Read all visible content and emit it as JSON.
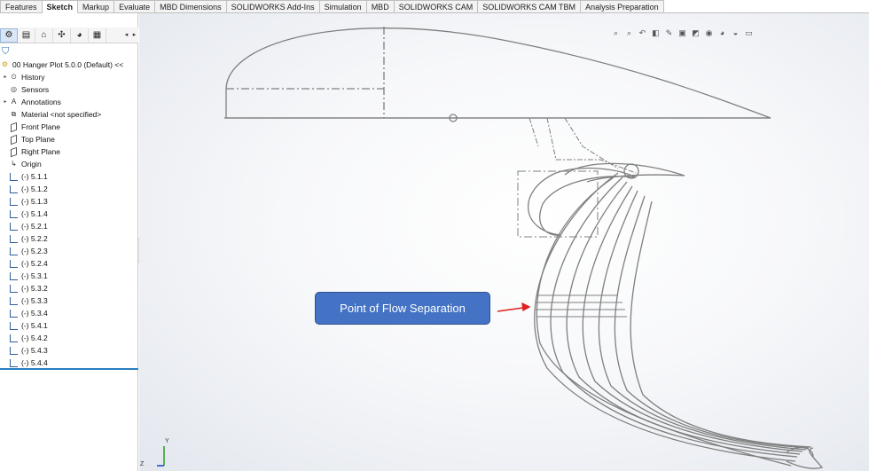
{
  "ribbon": {
    "tabs": [
      {
        "label": "Features"
      },
      {
        "label": "Sketch",
        "active": true
      },
      {
        "label": "Markup"
      },
      {
        "label": "Evaluate"
      },
      {
        "label": "MBD Dimensions"
      },
      {
        "label": "SOLIDWORKS Add-Ins"
      },
      {
        "label": "Simulation"
      },
      {
        "label": "MBD"
      },
      {
        "label": "SOLIDWORKS CAM"
      },
      {
        "label": "SOLIDWORKS CAM TBM"
      },
      {
        "label": "Analysis Preparation"
      }
    ]
  },
  "panel": {
    "toolbar_icons": [
      "feature-manager-icon",
      "property-manager-icon",
      "configuration-manager-icon",
      "dimxpert-icon",
      "display-manager-icon",
      "cam-icon"
    ],
    "tree": [
      {
        "label": "00 Hanger Plot 5.0.0 (Default) <<",
        "icon": "part-icon",
        "expandable": false,
        "indent": 0
      },
      {
        "label": "History",
        "icon": "history-icon",
        "expandable": true,
        "indent": 1
      },
      {
        "label": "Sensors",
        "icon": "sensors-icon",
        "expandable": false,
        "indent": 1
      },
      {
        "label": "Annotations",
        "icon": "annotations-icon",
        "expandable": true,
        "indent": 1
      },
      {
        "label": "Material <not specified>",
        "icon": "material-icon",
        "expandable": false,
        "indent": 1
      },
      {
        "label": "Front Plane",
        "icon": "plane-icon",
        "expandable": false,
        "indent": 1
      },
      {
        "label": "Top Plane",
        "icon": "plane-icon",
        "expandable": false,
        "indent": 1
      },
      {
        "label": "Right Plane",
        "icon": "plane-icon",
        "expandable": false,
        "indent": 1
      },
      {
        "label": "Origin",
        "icon": "origin-icon",
        "expandable": false,
        "indent": 1
      },
      {
        "label": "(-) 5.1.1",
        "icon": "sketch-icon",
        "expandable": false,
        "indent": 1
      },
      {
        "label": "(-) 5.1.2",
        "icon": "sketch-icon",
        "expandable": false,
        "indent": 1
      },
      {
        "label": "(-) 5.1.3",
        "icon": "sketch-icon",
        "expandable": false,
        "indent": 1
      },
      {
        "label": "(-) 5.1.4",
        "icon": "sketch-icon",
        "expandable": false,
        "indent": 1
      },
      {
        "label": "(-) 5.2.1",
        "icon": "sketch-icon",
        "expandable": false,
        "indent": 1
      },
      {
        "label": "(-) 5.2.2",
        "icon": "sketch-icon",
        "expandable": false,
        "indent": 1
      },
      {
        "label": "(-) 5.2.3",
        "icon": "sketch-icon",
        "expandable": false,
        "indent": 1
      },
      {
        "label": "(-) 5.2.4",
        "icon": "sketch-icon",
        "expandable": false,
        "indent": 1
      },
      {
        "label": "(-) 5.3.1",
        "icon": "sketch-icon",
        "expandable": false,
        "indent": 1
      },
      {
        "label": "(-) 5.3.2",
        "icon": "sketch-icon",
        "expandable": false,
        "indent": 1
      },
      {
        "label": "(-) 5.3.3",
        "icon": "sketch-icon",
        "expandable": false,
        "indent": 1
      },
      {
        "label": "(-) 5.3.4",
        "icon": "sketch-icon",
        "expandable": false,
        "indent": 1
      },
      {
        "label": "(-) 5.4.1",
        "icon": "sketch-icon",
        "expandable": false,
        "indent": 1
      },
      {
        "label": "(-) 5.4.2",
        "icon": "sketch-icon",
        "expandable": false,
        "indent": 1
      },
      {
        "label": "(-) 5.4.3",
        "icon": "sketch-icon",
        "expandable": false,
        "indent": 1
      },
      {
        "label": "(-) 5.4.4",
        "icon": "sketch-icon",
        "expandable": false,
        "indent": 1
      }
    ]
  },
  "viewport": {
    "callout": {
      "text": "Point of Flow Separation",
      "color": "#4472c4",
      "arrow_color": "#e02020"
    },
    "triad": {
      "y": "Y",
      "z": "Z"
    },
    "sketch_color": "#7f7f7f"
  }
}
